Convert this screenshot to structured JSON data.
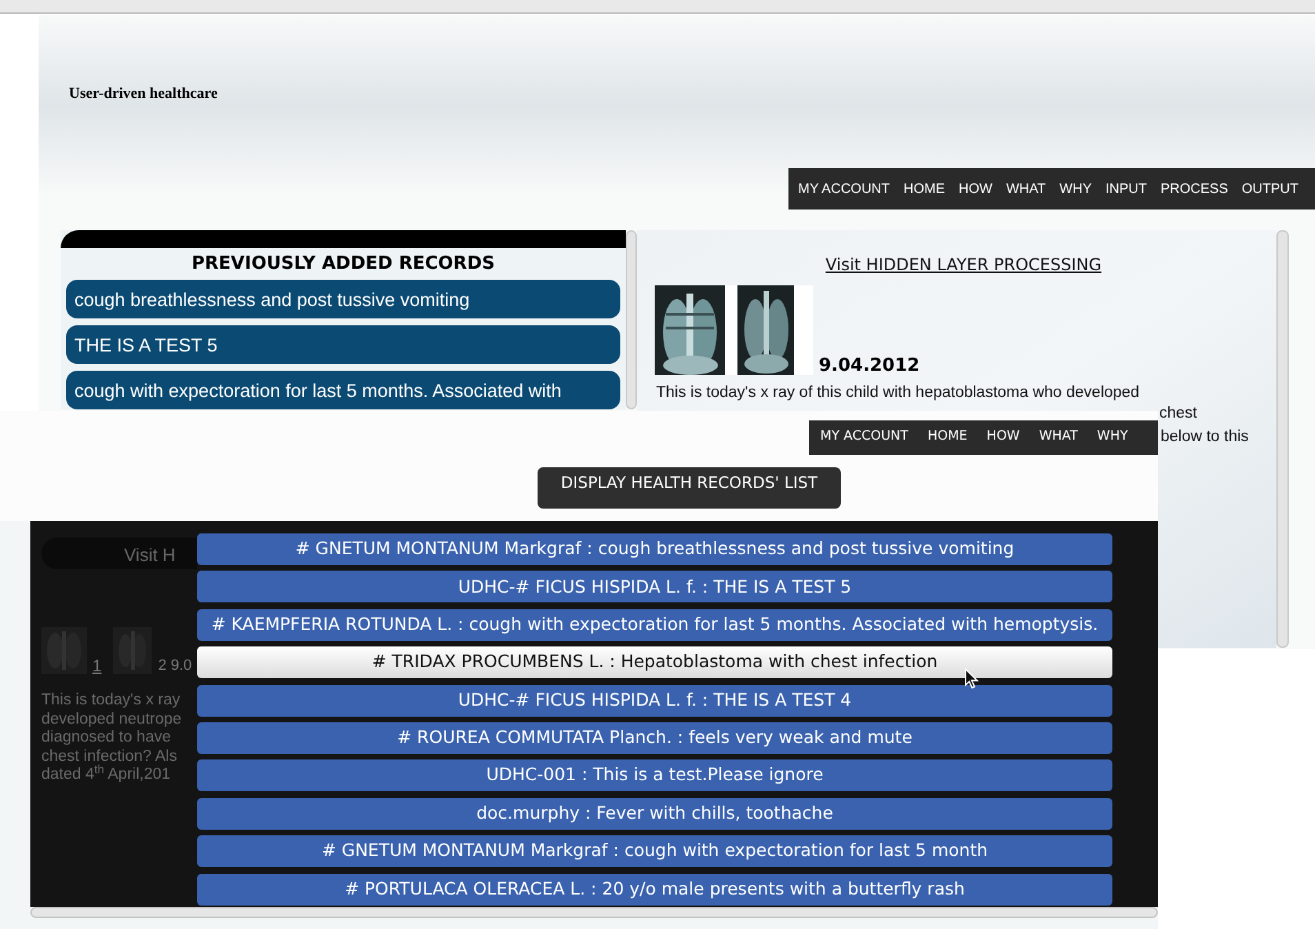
{
  "site": {
    "title": "User-driven healthcare",
    "nav": [
      "MY ACCOUNT",
      "HOME",
      "HOW",
      "WHAT",
      "WHY",
      "INPUT",
      "PROCESS",
      "OUTPUT"
    ]
  },
  "records_panel": {
    "heading": "PREVIOUSLY ADDED RECORDS",
    "items": [
      "cough breathlessness and post tussive vomiting",
      "THE IS A TEST 5",
      "cough with expectoration for last 5 months. Associated with"
    ]
  },
  "post_panel": {
    "link": "Visit HIDDEN LAYER PROCESSING",
    "date": "9.04.2012",
    "text": "This is today's x ray of this child with hepatoblastoma who developed",
    "fragments": [
      "chest",
      "below to this"
    ]
  },
  "second_window": {
    "nav": [
      "MY ACCOUNT",
      "HOME",
      "HOW",
      "WHAT",
      "WHY"
    ],
    "button": "DISPLAY HEALTH RECORDS' LIST",
    "background": {
      "button": "Visit H",
      "thumb_labels": [
        "1",
        "2 9.0"
      ],
      "text_lines": [
        "This is today's x ray",
        "developed neutrope",
        "diagnosed to have",
        "chest infection? Als",
        "dated 4$^{th}$ April,201"
      ]
    },
    "records": [
      {
        "label": "# GNETUM MONTANUM Markgraf : cough breathlessness and post tussive vomiting",
        "selected": false
      },
      {
        "label": "UDHC-# FICUS HISPIDA L. f. : THE IS A TEST 5",
        "selected": false
      },
      {
        "label": "# KAEMPFERIA ROTUNDA L. : cough with expectoration for last 5 months. Associated with hemoptysis.",
        "selected": false
      },
      {
        "label": "# TRIDAX PROCUMBENS L. : Hepatoblastoma with chest infection",
        "selected": true
      },
      {
        "label": "UDHC-# FICUS HISPIDA L. f. : THE IS A TEST 4",
        "selected": false
      },
      {
        "label": "# ROUREA COMMUTATA Planch. : feels very weak and mute",
        "selected": false
      },
      {
        "label": "UDHC-001 : This is a test.Please ignore",
        "selected": false
      },
      {
        "label": "doc.murphy : Fever with chills, toothache",
        "selected": false
      },
      {
        "label": "# GNETUM MONTANUM Markgraf : cough with expectoration for last 5 month",
        "selected": false
      },
      {
        "label": "# PORTULACA OLERACEA L. : 20 y/o male presents with a butterfly rash",
        "selected": false
      }
    ]
  }
}
